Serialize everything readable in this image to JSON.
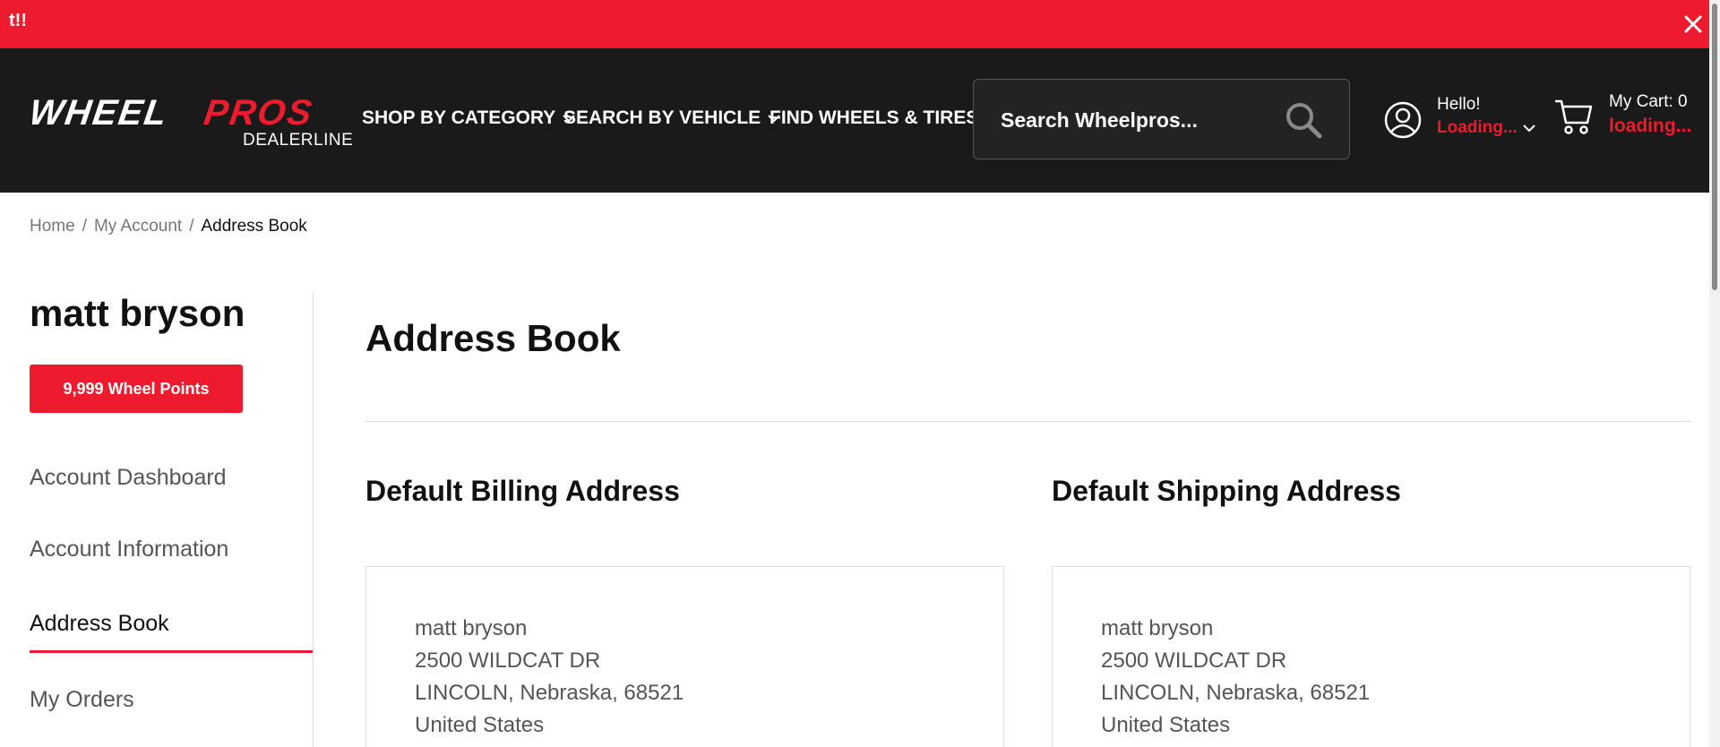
{
  "alert": {
    "text": "t!!",
    "close_icon": "close-icon"
  },
  "header": {
    "logo": {
      "word1": "WHEEL",
      "word2": "PROS",
      "subtitle": "DEALERLINE"
    },
    "nav": {
      "shop_by_category": "SHOP BY CATEGORY",
      "search_by_vehicle": "SEARCH BY VEHICLE",
      "find_wheels_tires": "FIND WHEELS & TIRES"
    },
    "search": {
      "placeholder": "Search Wheelpros..."
    },
    "user": {
      "greeting": "Hello!",
      "status": "Loading..."
    },
    "cart": {
      "label": "My Cart: 0",
      "status": "loading..."
    }
  },
  "breadcrumb": {
    "items": [
      {
        "label": "Home"
      },
      {
        "label": "My Account"
      },
      {
        "label": "Address Book"
      }
    ],
    "separator": "/"
  },
  "sidebar": {
    "user_name": "matt bryson",
    "points_label": "9,999 Wheel Points",
    "items": [
      {
        "label": "Account Dashboard"
      },
      {
        "label": "Account Information"
      },
      {
        "label": "Address Book",
        "active": true
      },
      {
        "label": "My Orders"
      }
    ]
  },
  "main": {
    "title": "Address Book",
    "billing": {
      "heading": "Default Billing Address",
      "lines": [
        "matt bryson",
        "2500 WILDCAT DR",
        "LINCOLN, Nebraska, 68521",
        "United States"
      ]
    },
    "shipping": {
      "heading": "Default Shipping Address",
      "lines": [
        "matt bryson",
        "2500 WILDCAT DR",
        "LINCOLN, Nebraska, 68521",
        "United States"
      ]
    }
  },
  "colors": {
    "brand_red": "#ec1c2e",
    "header_bg": "#1a1a1a",
    "text": "#111111",
    "muted": "#555555"
  }
}
